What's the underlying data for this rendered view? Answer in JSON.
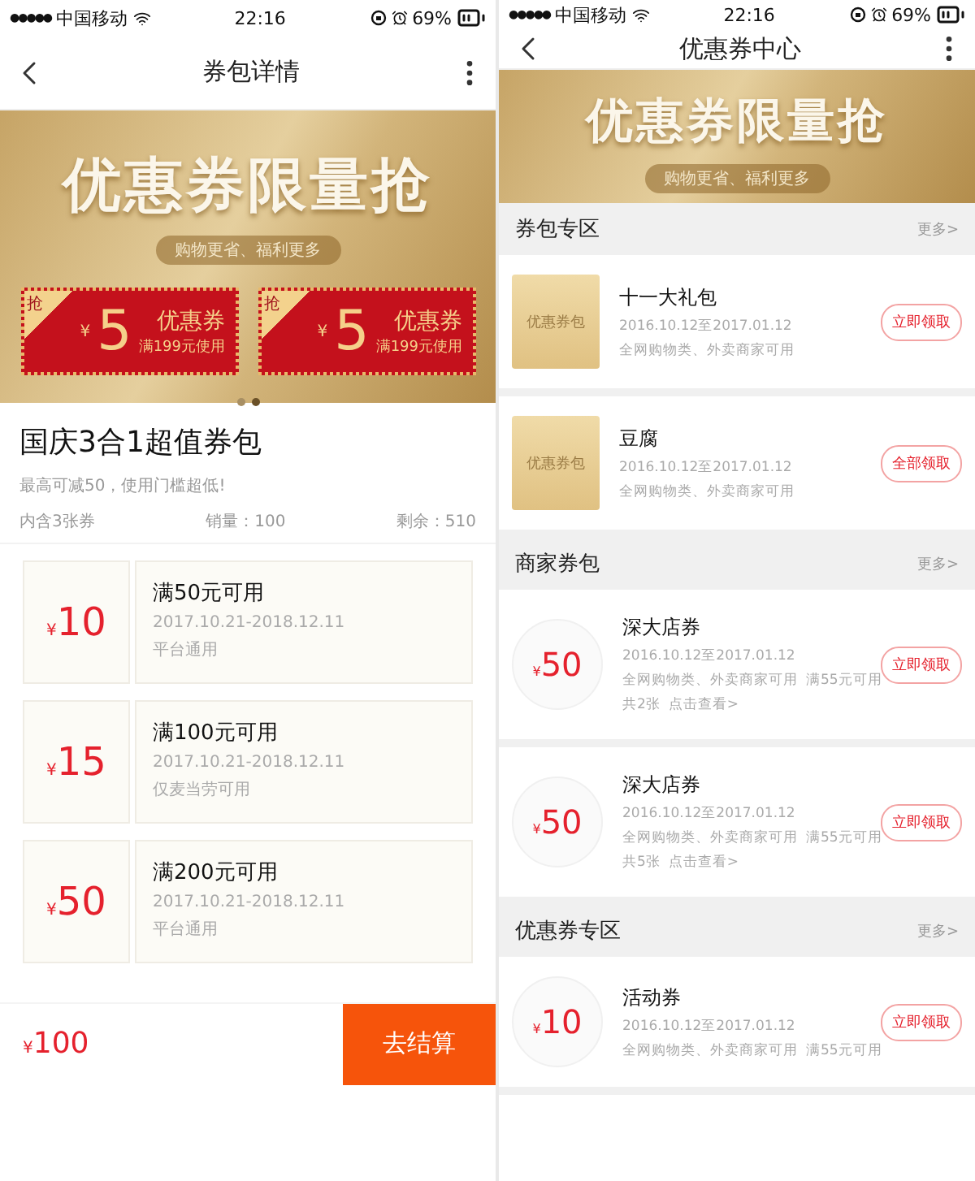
{
  "left_screen": {
    "status_bar": {
      "signal": "●●●●●",
      "carrier": "中国移动",
      "time": "22:16",
      "battery": "69%"
    },
    "nav": {
      "title": "券包详情"
    },
    "banner": {
      "headline": "优惠券限量抢",
      "tagline": "购物更省、福利更多",
      "coupons": [
        {
          "corner": "抢",
          "currency": "¥",
          "value": "5",
          "label": "优惠券",
          "condition": "满199元使用"
        },
        {
          "corner": "抢",
          "currency": "¥",
          "value": "5",
          "label": "优惠券",
          "condition": "满199元使用"
        }
      ],
      "dots": [
        {
          "selected": false
        },
        {
          "selected": true
        }
      ]
    },
    "package": {
      "title": "国庆3合1超值券包",
      "subtitle": "最高可减50，使用门槛超低!",
      "count": "内含3张券",
      "sales": "销量：100",
      "remaining": "剩余：510"
    },
    "coupons": [
      {
        "currency": "¥",
        "value": "10",
        "title": "满50元可用",
        "period": "2017.10.21-2018.12.11",
        "scope": "平台通用"
      },
      {
        "currency": "¥",
        "value": "15",
        "title": "满100元可用",
        "period": "2017.10.21-2018.12.11",
        "scope": "仅麦当劳可用"
      },
      {
        "currency": "¥",
        "value": "50",
        "title": "满200元可用",
        "period": "2017.10.21-2018.12.11",
        "scope": "平台通用"
      }
    ],
    "checkout": {
      "currency": "¥",
      "total": "100",
      "button": "去结算"
    }
  },
  "right_screen": {
    "status_bar": {
      "signal": "●●●●●",
      "carrier": "中国移动",
      "time": "22:16",
      "battery": "69%"
    },
    "nav": {
      "title": "优惠券中心"
    },
    "banner": {
      "headline": "优惠券限量抢",
      "tagline": "购物更省、福利更多"
    },
    "sections": [
      {
        "title": "券包专区",
        "more": "更多>",
        "items": [
          {
            "kind": "package",
            "badge": "优惠券包",
            "title": "十一大礼包",
            "date": "2016.10.12至2017.01.12",
            "scope": "全网购物类、外卖商家可用",
            "button": "立即领取"
          },
          {
            "kind": "package",
            "badge": "优惠券包",
            "title": "豆腐",
            "date": "2016.10.12至2017.01.12",
            "scope": "全网购物类、外卖商家可用",
            "button": "全部领取"
          }
        ]
      },
      {
        "title": "商家券包",
        "more": "更多>",
        "items": [
          {
            "kind": "amount",
            "currency": "¥",
            "value": "50",
            "title": "深大店券",
            "date": "2016.10.12至2017.01.12",
            "scope": "全网购物类、外卖商家可用",
            "condition": "满55元可用",
            "count": "共2张",
            "link": "点击查看>",
            "button": "立即领取"
          },
          {
            "kind": "amount",
            "currency": "¥",
            "value": "50",
            "title": "深大店券",
            "date": "2016.10.12至2017.01.12",
            "scope": "全网购物类、外卖商家可用",
            "condition": "满55元可用",
            "count": "共5张",
            "link": "点击查看>",
            "button": "立即领取"
          }
        ]
      },
      {
        "title": "优惠券专区",
        "more": "更多>",
        "items": [
          {
            "kind": "amount",
            "currency": "¥",
            "value": "10",
            "title": "活动券",
            "date": "2016.10.12至2017.01.12",
            "scope": "全网购物类、外卖商家可用",
            "condition": "满55元可用",
            "button": "立即领取"
          },
          {
            "kind": "partial"
          }
        ]
      }
    ]
  }
}
